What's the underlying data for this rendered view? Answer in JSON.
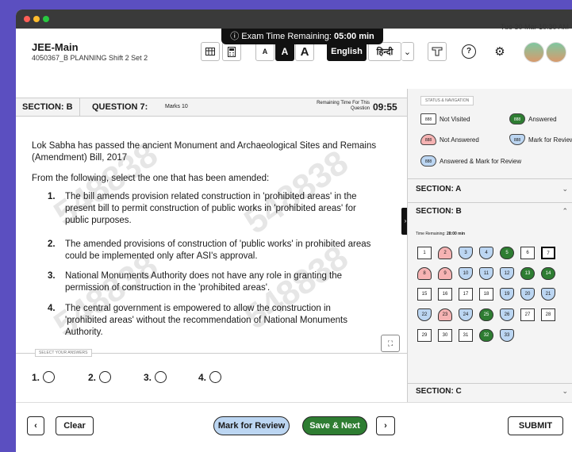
{
  "exam": {
    "timer_prefix": "ⓘ Exam Time Remaining:",
    "timer_value": "05:00 min",
    "title": "JEE-Main",
    "subtitle": "4050367_B PLANNING Shift 2 Set 2",
    "datetime": "Tue 30 Mar 10:30 AM"
  },
  "toolbar": {
    "font_small": "A",
    "font_medium": "A",
    "font_large": "A",
    "lang_english": "English",
    "lang_hindi": "हिन्दी",
    "lang_chevron": "⌄",
    "help": "?",
    "settings": "⚙"
  },
  "question_bar": {
    "section": "SECTION: B",
    "question": "QUESTION 7:",
    "marks": "Marks 10",
    "remaining_label": "Remaining Time For This Question",
    "remaining_value": "09:55"
  },
  "question": {
    "stem": "Lok Sabha has passed the ancient Monument and Archaeological Sites and Remains (Amendment) Bill, 2017",
    "prompt": "From the following, select the one that has been amended:",
    "watermark": "548838",
    "options": [
      {
        "num": "1.",
        "text": "The bill amends provision related construction in 'prohibited areas' in the present bill to permit construction of public works in 'prohibited areas' for public purposes."
      },
      {
        "num": "2.",
        "text": "The amended provisions of construction of 'public works' in prohibited areas could be implemented only after ASI's approval."
      },
      {
        "num": "3.",
        "text": "National Monuments Authority does not have any role in granting the permission of construction in the 'prohibited areas'."
      },
      {
        "num": "4.",
        "text": "The central government is empowered to allow the construction in 'prohibited areas' without the recommendation of National Monuments Authority."
      }
    ]
  },
  "answers": {
    "label": "SELECT YOUR ANSWERS",
    "choices": [
      "1.",
      "2.",
      "3.",
      "4."
    ]
  },
  "status_panel": {
    "label": "STATUS & NAVIGATION",
    "legend_code": "888",
    "not_visited": "Not Visited",
    "answered": "Answered",
    "not_answered": "Not Answered",
    "mark_review": "Mark for Review",
    "answered_mark": "Answered & Mark for Review",
    "section_a": "SECTION: A",
    "section_b": "SECTION: B",
    "section_c": "SECTION: C",
    "time_remaining_label": "Time Remaining:",
    "time_remaining_value": "28:00 min",
    "questions": [
      {
        "n": "1",
        "s": "nv"
      },
      {
        "n": "2",
        "s": "na"
      },
      {
        "n": "3",
        "s": "mr"
      },
      {
        "n": "4",
        "s": "mr"
      },
      {
        "n": "5",
        "s": "an"
      },
      {
        "n": "6",
        "s": "nv"
      },
      {
        "n": "7",
        "s": "cur"
      },
      {
        "n": "8",
        "s": "na"
      },
      {
        "n": "9",
        "s": "na"
      },
      {
        "n": "10",
        "s": "mr"
      },
      {
        "n": "11",
        "s": "mr"
      },
      {
        "n": "12",
        "s": "mr"
      },
      {
        "n": "13",
        "s": "an"
      },
      {
        "n": "14",
        "s": "an"
      },
      {
        "n": "15",
        "s": "nv"
      },
      {
        "n": "16",
        "s": "nv"
      },
      {
        "n": "17",
        "s": "nv"
      },
      {
        "n": "18",
        "s": "nv"
      },
      {
        "n": "19",
        "s": "mr"
      },
      {
        "n": "20",
        "s": "mr"
      },
      {
        "n": "21",
        "s": "mr"
      },
      {
        "n": "22",
        "s": "mr"
      },
      {
        "n": "23",
        "s": "na"
      },
      {
        "n": "24",
        "s": "mr"
      },
      {
        "n": "25",
        "s": "an"
      },
      {
        "n": "26",
        "s": "mr"
      },
      {
        "n": "27",
        "s": "nv"
      },
      {
        "n": "28",
        "s": "nv"
      },
      {
        "n": "29",
        "s": "nv"
      },
      {
        "n": "30",
        "s": "nv"
      },
      {
        "n": "31",
        "s": "nv"
      },
      {
        "n": "32",
        "s": "an"
      },
      {
        "n": "33",
        "s": "mr"
      }
    ]
  },
  "footer": {
    "prev": "‹",
    "clear": "Clear",
    "mark_review": "Mark for Review",
    "save_next": "Save & Next",
    "next": "›",
    "submit": "SUBMIT"
  }
}
